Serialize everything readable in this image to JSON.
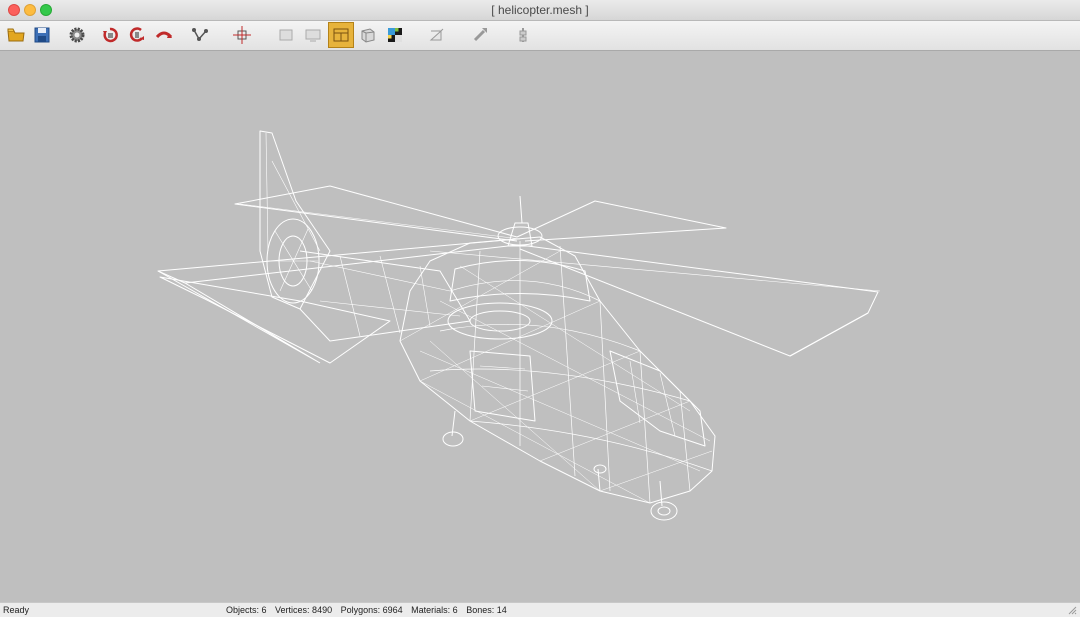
{
  "window": {
    "title": "[ helicopter.mesh ]"
  },
  "toolbar": {
    "buttons": [
      {
        "icon": "open-folder-icon",
        "label": "Open"
      },
      {
        "icon": "save-icon",
        "label": "Save"
      },
      {
        "icon": "settings-gear-icon",
        "label": "Settings"
      },
      {
        "icon": "rotate-x-icon",
        "label": "Rotate X"
      },
      {
        "icon": "rotate-y-icon",
        "label": "Rotate Y"
      },
      {
        "icon": "rotate-z-icon",
        "label": "Rotate Z"
      },
      {
        "icon": "skeleton-icon",
        "label": "Skeleton"
      },
      {
        "icon": "center-icon",
        "label": "Center"
      },
      {
        "icon": "view-front-icon",
        "label": "Front view"
      },
      {
        "icon": "view-side-icon",
        "label": "Side view"
      },
      {
        "icon": "wireframe-icon",
        "label": "Wireframe",
        "active": true
      },
      {
        "icon": "solid-shading-icon",
        "label": "Solid"
      },
      {
        "icon": "texture-checker-icon",
        "label": "Textured"
      },
      {
        "icon": "bounding-box-icon",
        "label": "Bounds"
      },
      {
        "icon": "normals-icon",
        "label": "Normals"
      },
      {
        "icon": "bones-icon",
        "label": "Bones"
      }
    ]
  },
  "status": {
    "left": "Ready",
    "objects": "Objects: 6",
    "vertices": "Vertices: 8490",
    "polygons": "Polygons: 6964",
    "materials": "Materials: 6",
    "bones": "Bones: 14"
  },
  "colors": {
    "viewport_bg": "#bfbfbf",
    "wireframe": "#ffffff",
    "active_tool": "#e7b33c"
  }
}
